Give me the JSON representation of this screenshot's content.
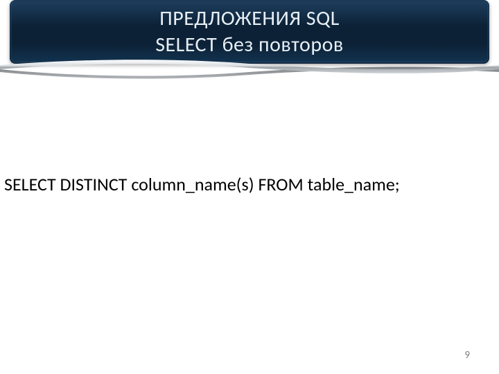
{
  "title": {
    "line1": "ПРЕДЛОЖЕНИЯ SQL",
    "line2": "SELECT без повторов"
  },
  "body": "SELECT DISTINCT column_name(s) FROM table_name;",
  "page_number": "9"
}
